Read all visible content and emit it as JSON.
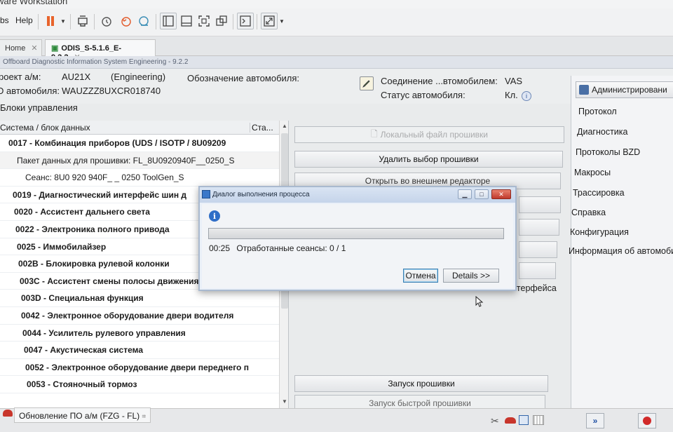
{
  "vmware": {
    "window_title": "ware Workstation",
    "menu": [
      "bs",
      "Help"
    ],
    "tabs": [
      {
        "label": "Home",
        "active": false
      },
      {
        "label": "ODIS_S-5.1.6_E-9.2.2",
        "active": true
      }
    ]
  },
  "odis": {
    "titlebar": "Offboard Diagnostic Information System Engineering - 9.2.2",
    "project_label": "роект а/м:",
    "project_value": "AU21X",
    "project_mode": "(Engineering)",
    "designation_label": "Обозначение автомобиля:",
    "vin_label": "D автомобиля:",
    "vin_value": "WAUZZZ8UXCR018740",
    "connection_label": "Соединение ...втомобилем:",
    "connection_value": "VAS",
    "status_label": "Статус автомобиля:",
    "status_value": "Кл."
  },
  "control_units": {
    "heading": "Блоки управления",
    "col_system": "Система / блок данных",
    "col_status": "Ста...",
    "rows": [
      {
        "text": "0017 - Комбинация приборов  (UDS / ISOTP / 8U09209",
        "bold": true,
        "indent": 12
      },
      {
        "text": "Пакет данных для прошивки: FL_8U0920940F__0250_S",
        "bold": false,
        "indent": 24,
        "selected": true
      },
      {
        "text": "Сеанс: 8U0 920 940F_ _ 0250 ToolGen_S",
        "bold": false,
        "indent": 36
      },
      {
        "text": "0019 - Диагностический интерфейс шин д",
        "bold": true,
        "indent": 18
      },
      {
        "text": "0020 - Ассистент дальнего света",
        "bold": true,
        "indent": 20
      },
      {
        "text": "0022 - Электроника полного привода",
        "bold": true,
        "indent": 22
      },
      {
        "text": "0025 - Иммобилайзер",
        "bold": true,
        "indent": 24
      },
      {
        "text": "002B - Блокировка рулевой колонки",
        "bold": true,
        "indent": 26
      },
      {
        "text": "003C - Ассистент смены полосы движения",
        "bold": true,
        "indent": 28
      },
      {
        "text": "003D - Специальная функция",
        "bold": true,
        "indent": 30
      },
      {
        "text": "0042 - Электронное оборудование двери водителя",
        "bold": true,
        "indent": 30
      },
      {
        "text": "0044 - Усилитель рулевого управления",
        "bold": true,
        "indent": 32
      },
      {
        "text": "0047 - Акустическая система",
        "bold": true,
        "indent": 34
      },
      {
        "text": "0052 - Электронное оборудование двери переднего п",
        "bold": true,
        "indent": 36
      },
      {
        "text": "0053 - Стояночный тормоз",
        "bold": true,
        "indent": 38
      }
    ]
  },
  "flash_buttons": {
    "local_file": "Локальный файл прошивки",
    "delete_selection": "Удалить выбор прошивки",
    "open_external": "Открыть во внешнем редакторе",
    "interface_partial": "нтерфейса",
    "start_flash": "Запуск прошивки",
    "start_fast_flash": "Запуск быстрой прошивки"
  },
  "right_panel": {
    "admin": "Администрировани",
    "items": [
      "Протокол",
      "Диагностика",
      "Протоколы BZD",
      "Макросы",
      "Трассировка",
      "Справка",
      "Конфигурация",
      "Информация об автомоби"
    ]
  },
  "status_bar": {
    "tab_label": "Обновление ПО а/м (FZG - FL)",
    "tab_suffix": "⌗"
  },
  "dialog": {
    "title": "Диалог выполнения процесса",
    "progress": 0.0,
    "time": "00:25",
    "status_text": "Отработанные сеансы: 0 / 1",
    "cancel": "Отмена",
    "details": "Details >>"
  },
  "colors": {
    "dialog_title": "#c5d4ea",
    "close_button": "#c0392b",
    "info_icon": "#2f6ec7"
  }
}
